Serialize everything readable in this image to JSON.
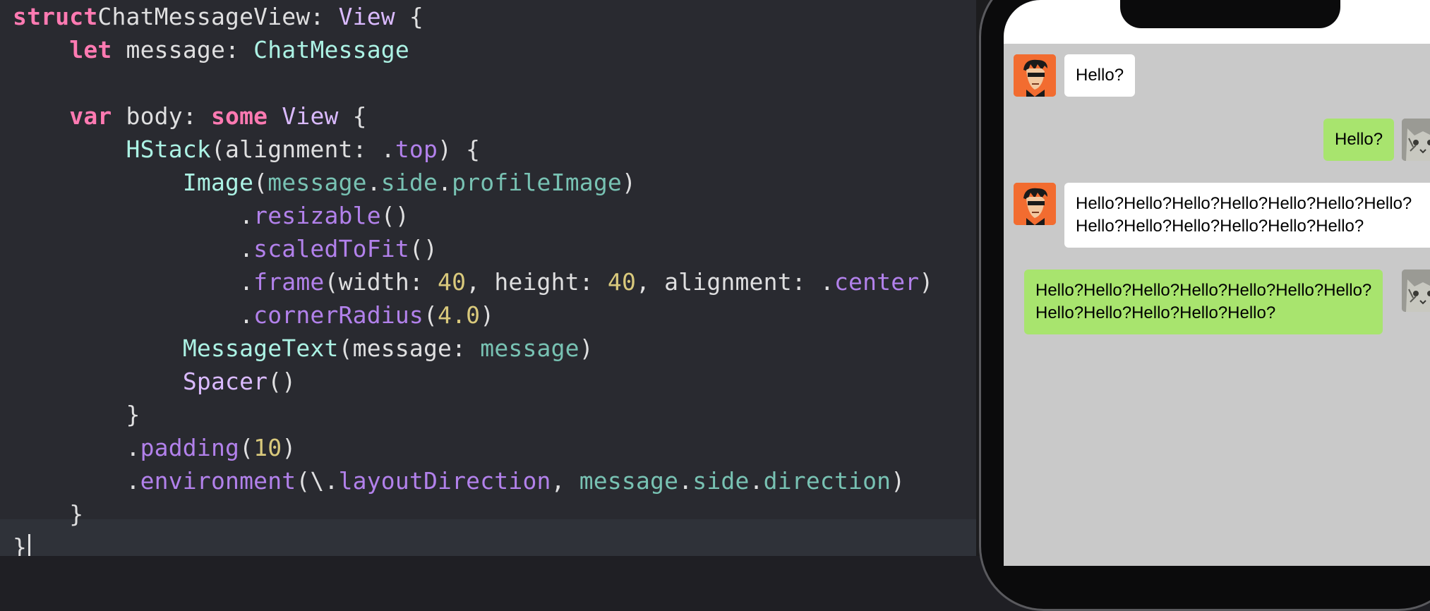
{
  "editor": {
    "lines": [
      [
        [
          "kw",
          "struct"
        ],
        [
          "",
          "ChatMessageView: "
        ],
        [
          "ty",
          "View"
        ],
        [
          "",
          " {"
        ]
      ],
      [
        [
          "",
          "    "
        ],
        [
          "kw",
          "let"
        ],
        [
          "",
          " message: "
        ],
        [
          "pty",
          "ChatMessage"
        ]
      ],
      [
        [
          "",
          ""
        ]
      ],
      [
        [
          "",
          "    "
        ],
        [
          "kw",
          "var"
        ],
        [
          "",
          " body: "
        ],
        [
          "kw",
          "some"
        ],
        [
          "",
          " "
        ],
        [
          "ty",
          "View"
        ],
        [
          "",
          " {"
        ]
      ],
      [
        [
          "",
          "        "
        ],
        [
          "pty",
          "HStack"
        ],
        [
          "",
          "(alignment: ."
        ],
        [
          "fn",
          "top"
        ],
        [
          "",
          ") {"
        ]
      ],
      [
        [
          "",
          "            "
        ],
        [
          "pty",
          "Image"
        ],
        [
          "",
          "("
        ],
        [
          "mem",
          "message"
        ],
        [
          "",
          "."
        ],
        [
          "mem",
          "side"
        ],
        [
          "",
          "."
        ],
        [
          "mem",
          "profileImage"
        ],
        [
          "",
          ")"
        ]
      ],
      [
        [
          "",
          "                ."
        ],
        [
          "fn",
          "resizable"
        ],
        [
          "",
          "()"
        ]
      ],
      [
        [
          "",
          "                ."
        ],
        [
          "fn",
          "scaledToFit"
        ],
        [
          "",
          "()"
        ]
      ],
      [
        [
          "",
          "                ."
        ],
        [
          "fn",
          "frame"
        ],
        [
          "",
          "(width: "
        ],
        [
          "num",
          "40"
        ],
        [
          "",
          ", height: "
        ],
        [
          "num",
          "40"
        ],
        [
          "",
          ", alignment: ."
        ],
        [
          "fn",
          "center"
        ],
        [
          "",
          ")"
        ]
      ],
      [
        [
          "",
          "                ."
        ],
        [
          "fn",
          "cornerRadius"
        ],
        [
          "",
          "("
        ],
        [
          "num",
          "4.0"
        ],
        [
          "",
          ")"
        ]
      ],
      [
        [
          "",
          "            "
        ],
        [
          "pty",
          "MessageText"
        ],
        [
          "",
          "(message: "
        ],
        [
          "mem",
          "message"
        ],
        [
          "",
          ")"
        ]
      ],
      [
        [
          "",
          "            "
        ],
        [
          "ty",
          "Spacer"
        ],
        [
          "",
          "()"
        ]
      ],
      [
        [
          "",
          "        }"
        ]
      ],
      [
        [
          "",
          "        ."
        ],
        [
          "fn",
          "padding"
        ],
        [
          "",
          "("
        ],
        [
          "num",
          "10"
        ],
        [
          "",
          ")"
        ]
      ],
      [
        [
          "",
          "        ."
        ],
        [
          "fn",
          "environment"
        ],
        [
          "",
          "(\\."
        ],
        [
          "fn",
          "layoutDirection"
        ],
        [
          "",
          ", "
        ],
        [
          "mem",
          "message"
        ],
        [
          "",
          "."
        ],
        [
          "mem",
          "side"
        ],
        [
          "",
          "."
        ],
        [
          "mem",
          "direction"
        ],
        [
          "",
          ")"
        ]
      ],
      [
        [
          "",
          "    }"
        ]
      ],
      [
        [
          "",
          "}"
        ]
      ]
    ]
  },
  "preview": {
    "messages": [
      {
        "side": "left",
        "text": "Hello?"
      },
      {
        "side": "right",
        "text": "Hello?"
      },
      {
        "side": "left",
        "text": "Hello?Hello?Hello?Hello?Hello?Hello?Hello?\nHello?Hello?Hello?Hello?Hello?Hello?"
      },
      {
        "side": "right",
        "text": "Hello?Hello?Hello?Hello?Hello?Hello?Hello?\nHello?Hello?Hello?Hello?Hello?"
      }
    ],
    "colors": {
      "left_bubble": "#ffffff",
      "right_bubble": "#a8e46e",
      "chat_background": "#c9c9c9"
    },
    "icons": {
      "left_avatar": "cartoon-man-sunglasses-avatar",
      "right_avatar": "gray-cat-avatar"
    }
  }
}
